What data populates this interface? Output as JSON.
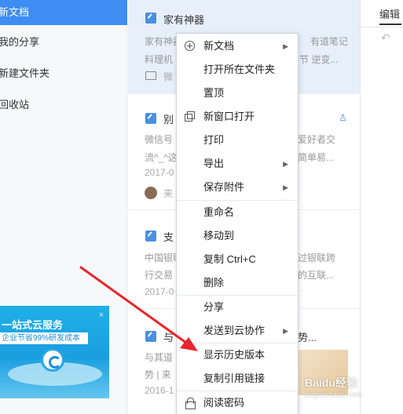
{
  "sidebar": {
    "items": [
      {
        "label": "新文档",
        "active": true
      },
      {
        "label": "我的分享",
        "active": false
      },
      {
        "label": "新建文件夹",
        "active": false
      },
      {
        "label": "回收站",
        "active": false
      }
    ],
    "ad": {
      "title": "一站式云服务",
      "subtitle": "企业节省99%研发成本",
      "close": "×"
    }
  },
  "list": {
    "cards": [
      {
        "title": "家有神器",
        "line1": "家有神器",
        "line1_right": "有道笔记",
        "line2": "料理机",
        "line2_right": "节 逆变...",
        "meta": "微",
        "meta_icon": "folder-icon"
      },
      {
        "title": "别",
        "line1": "微信号",
        "line1_right": "爱好者交",
        "line2": "流^_^这",
        "line2_right": "简单易...",
        "meta": "2017-0",
        "meta2": "来"
      },
      {
        "title": "支",
        "line1": "中国银联",
        "line1_right": "过银联跨",
        "line2": "行交易",
        "line2_right": "的互联...",
        "meta": "2017-0"
      },
      {
        "title": "与",
        "title_right": "势...",
        "line1": "与其道",
        "line2": "势 | 来",
        "meta": "2016-1"
      }
    ]
  },
  "right_panel": {
    "edit_tab": "编辑",
    "undo_icon": "↶"
  },
  "context_menu": {
    "items": [
      {
        "label": "新文档",
        "icon": "plus-circle-icon",
        "submenu": true
      },
      {
        "label": "打开所在文件夹"
      },
      {
        "label": "置顶"
      },
      {
        "label": "新窗口打开",
        "icon": "new-window-icon"
      },
      {
        "label": "打印"
      },
      {
        "label": "导出",
        "submenu": true
      },
      {
        "label": "保存附件",
        "submenu": true
      },
      {
        "label": "重命名"
      },
      {
        "label": "移动到"
      },
      {
        "label": "复制 Ctrl+C"
      },
      {
        "label": "删除"
      },
      {
        "label": "分享"
      },
      {
        "label": "发送到云协作",
        "submenu": true
      },
      {
        "label": "显示历史版本"
      },
      {
        "label": "复制引用链接"
      },
      {
        "label": "阅读密码",
        "icon": "lock-icon"
      }
    ],
    "submenu_arrow": "▶"
  },
  "watermark": {
    "text": "Baidu经验",
    "sub": "jingyan.baidu.com"
  },
  "colors": {
    "accent": "#3f8cf3",
    "annotation": "#e8262d",
    "selected_card": "#e7effb"
  }
}
